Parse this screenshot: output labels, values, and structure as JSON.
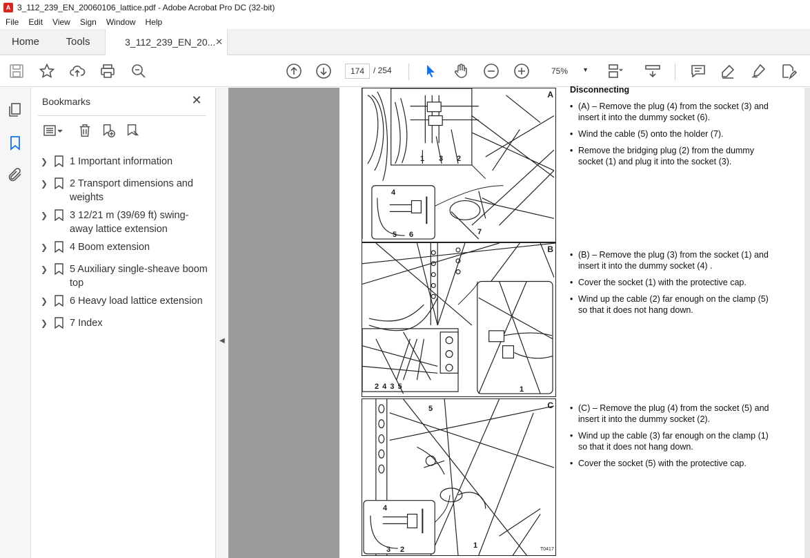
{
  "window": {
    "title": "3_112_239_EN_20060106_lattice.pdf - Adobe Acrobat Pro DC (32-bit)"
  },
  "menu": [
    "File",
    "Edit",
    "View",
    "Sign",
    "Window",
    "Help"
  ],
  "tabs": {
    "home": "Home",
    "tools": "Tools",
    "document": "3_112_239_EN_20..."
  },
  "toolbar": {
    "current_page": "174",
    "total_pages": "/ 254",
    "zoom": "75%"
  },
  "bookmarks": {
    "title": "Bookmarks",
    "items": [
      {
        "label": "1 Important information"
      },
      {
        "label": "2 Transport dimensions and weights"
      },
      {
        "label": "3 12/21 m (39/69 ft) swing-away lattice extension"
      },
      {
        "label": "4 Boom extension"
      },
      {
        "label": "5 Auxiliary single-sheave boom top"
      },
      {
        "label": "6 Heavy load lattice extension"
      },
      {
        "label": "7 Index"
      }
    ]
  },
  "document": {
    "heading": "Disconnecting",
    "figure_a": {
      "letter": "A",
      "labels": [
        "1",
        "3",
        "2",
        "4",
        "5",
        "6",
        "7"
      ]
    },
    "figure_b": {
      "letter": "B",
      "labels": [
        "2 4 3 5",
        "1"
      ]
    },
    "figure_c": {
      "letter": "C",
      "labels": [
        "5",
        "4",
        "3",
        "2",
        "1"
      ],
      "code": "T0417"
    },
    "section_a": [
      "(A) – Remove the plug (4) from the socket (3) and insert it into the dummy socket (6).",
      "Wind the cable (5) onto the holder (7).",
      "Remove the bridging plug (2) from the dummy socket (1) and plug it into the socket (3)."
    ],
    "section_b": [
      "(B) – Remove the plug (3) from the socket (1) and insert it into the dummy socket (4) .",
      "Cover the socket (1) with the protective cap.",
      " Wind up the cable (2) far enough on the clamp (5) so that it does not hang down."
    ],
    "section_c": [
      "(C) – Remove the plug (4) from the socket (5) and insert it into the dummy socket (2).",
      "Wind up the cable (3) far enough on the clamp (1) so that it does not hang down.",
      "Cover the socket (5) with the protective cap."
    ]
  },
  "icons": {
    "accent": "#1473e6",
    "pdf_icon": "#d7261e"
  }
}
